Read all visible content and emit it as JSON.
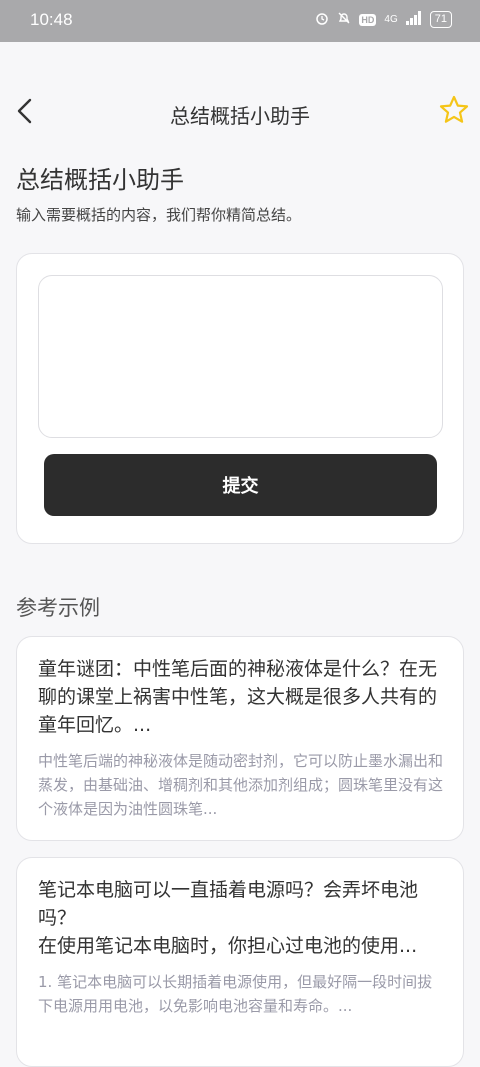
{
  "status": {
    "time": "10:48",
    "network": "4G",
    "hd": "HD",
    "battery": "71"
  },
  "nav": {
    "title": "总结概括小助手"
  },
  "header": {
    "title": "总结概括小助手",
    "subtitle": "输入需要概括的内容，我们帮你精简总结。"
  },
  "form": {
    "input_value": "",
    "submit_label": "提交"
  },
  "examples": {
    "title": "参考示例",
    "items": [
      {
        "question": "童年谜团：中性笔后面的神秘液体是什么？在无聊的课堂上祸害中性笔，这大概是很多人共有的童年回忆。...",
        "answer": "中性笔后端的神秘液体是随动密封剂，它可以防止墨水漏出和蒸发，由基础油、增稠剂和其他添加剂组成；圆珠笔里没有这个液体是因为油性圆珠笔..."
      },
      {
        "question": "笔记本电脑可以一直插着电源吗？会弄坏电池吗？\n在使用笔记本电脑时，你担心过电池的使用...",
        "answer": "1. 笔记本电脑可以长期插着电源使用，但最好隔一段时间拔下电源用用电池，以免影响电池容量和寿命。..."
      }
    ]
  },
  "colors": {
    "status_bar": "#a9a9ab",
    "background": "#f7f7f9",
    "button": "#2c2c2c",
    "star": "#f5c518"
  },
  "icons": {
    "back": "chevron-left-icon",
    "favorite": "star-outline-icon"
  }
}
